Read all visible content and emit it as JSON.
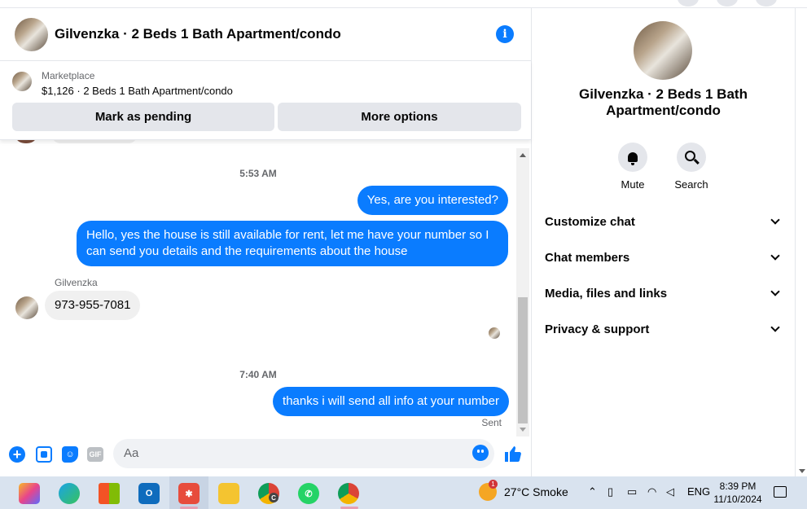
{
  "chat": {
    "title": "Gilvenzka · 2 Beds 1 Bath Apartment/condo",
    "info_glyph": "i"
  },
  "marketplace": {
    "label": "Marketplace",
    "listing": "$1,126 · 2 Beds 1 Bath Apartment/condo",
    "mark_pending": "Mark as pending",
    "more_options": "More options"
  },
  "messages": {
    "time1": "5:53 AM",
    "msg1": "Yes, are you interested?",
    "msg2": "Hello, yes the house is still available for rent, let me have your number so I can send you details and the requirements about the house",
    "sender": "Gilvenzka",
    "msg3": "973-955-7081",
    "time2": "7:40 AM",
    "msg4": "thanks i will send all info at your number",
    "status": "Sent"
  },
  "composer": {
    "placeholder": "Aa",
    "plus_glyph": "+",
    "gif_label": "GIF"
  },
  "panel": {
    "title": "Gilvenzka · 2 Beds 1 Bath Apartment/condo",
    "mute": "Mute",
    "search": "Search",
    "sections": [
      "Customize chat",
      "Chat members",
      "Media, files and links",
      "Privacy & support"
    ]
  },
  "taskbar": {
    "weather": "27°C  Smoke",
    "weather_badge": "1",
    "language": "ENG",
    "time": "8:39 PM",
    "date": "11/10/2024",
    "chrome_badge": "C"
  },
  "colors": {
    "accent": "#0a7cff",
    "bubble_in": "#f0f0f0",
    "button_gray": "#e4e6eb",
    "taskbar": "#d9e3ef"
  }
}
